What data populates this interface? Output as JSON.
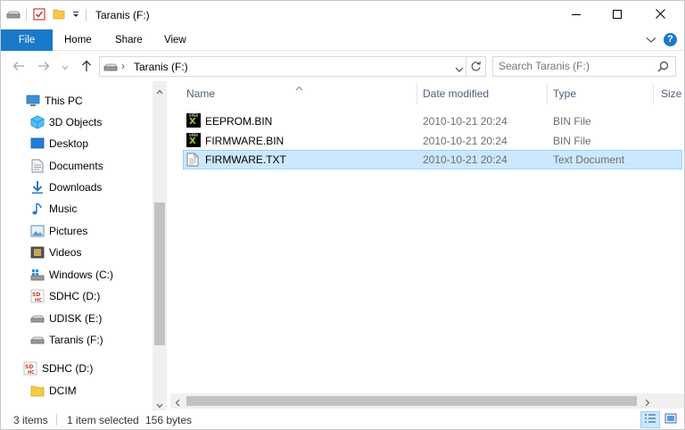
{
  "window": {
    "title": "Taranis (F:)",
    "buttons": {
      "minimize": "minimize-icon",
      "maximize": "maximize-icon",
      "close": "close-icon"
    }
  },
  "ribbon": {
    "tabs": [
      {
        "label": "File"
      },
      {
        "label": "Home"
      },
      {
        "label": "Share"
      },
      {
        "label": "View"
      }
    ],
    "help_label": "?"
  },
  "address": {
    "path": "Taranis (F:)",
    "separator": "›"
  },
  "search": {
    "placeholder": "Search Taranis (F:)"
  },
  "nav": {
    "items": [
      {
        "label": "This PC",
        "icon": "pc-icon"
      },
      {
        "label": "3D Objects",
        "icon": "cube-icon"
      },
      {
        "label": "Desktop",
        "icon": "desktop-icon"
      },
      {
        "label": "Documents",
        "icon": "documents-icon"
      },
      {
        "label": "Downloads",
        "icon": "download-icon"
      },
      {
        "label": "Music",
        "icon": "music-icon"
      },
      {
        "label": "Pictures",
        "icon": "pictures-icon"
      },
      {
        "label": "Videos",
        "icon": "videos-icon"
      },
      {
        "label": "Windows (C:)",
        "icon": "windows-drive-icon"
      },
      {
        "label": "SDHC (D:)",
        "icon": "sd-card-icon"
      },
      {
        "label": "UDISK (E:)",
        "icon": "drive-icon"
      },
      {
        "label": "Taranis (F:)",
        "icon": "drive-icon"
      },
      {
        "label": "SDHC (D:)",
        "icon": "sd-card-icon"
      },
      {
        "label": "DCIM",
        "icon": "folder-icon"
      }
    ]
  },
  "columns": {
    "name": "Name",
    "date_modified": "Date modified",
    "type": "Type",
    "size": "Size"
  },
  "files": [
    {
      "name": "EEPROM.BIN",
      "date": "2010-10-21 20:24",
      "type": "BIN File",
      "icon": "opentx-icon",
      "selected": false
    },
    {
      "name": "FIRMWARE.BIN",
      "date": "2010-10-21 20:24",
      "type": "BIN File",
      "icon": "opentx-icon",
      "selected": false
    },
    {
      "name": "FIRMWARE.TXT",
      "date": "2010-10-21 20:24",
      "type": "Text Document",
      "icon": "text-document-icon",
      "selected": true
    }
  ],
  "status": {
    "item_count": "3 items",
    "selection": "1 item selected",
    "size": "156 bytes"
  },
  "colors": {
    "accent": "#1979ca",
    "selection_bg": "#cce8ff",
    "selection_border": "#99d1ff"
  }
}
